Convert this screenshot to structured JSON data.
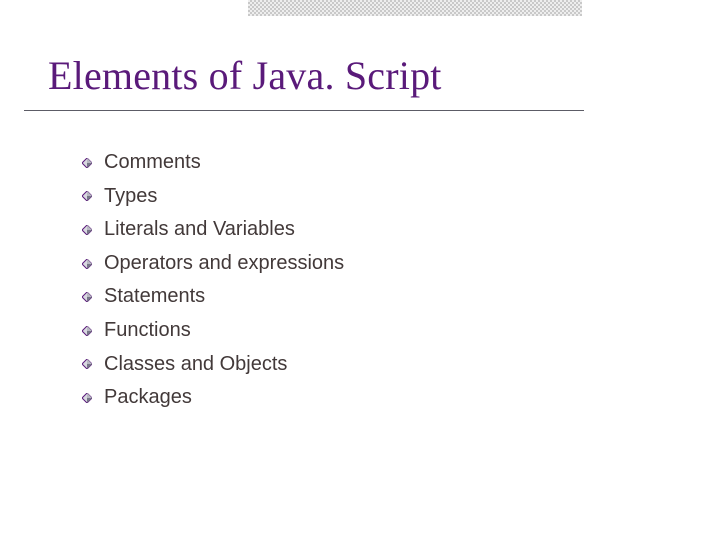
{
  "title": "Elements of Java. Script",
  "bullets": [
    "Comments",
    "Types",
    "Literals and Variables",
    "Operators and expressions",
    "Statements",
    "Functions",
    "Classes and Objects",
    "Packages"
  ]
}
